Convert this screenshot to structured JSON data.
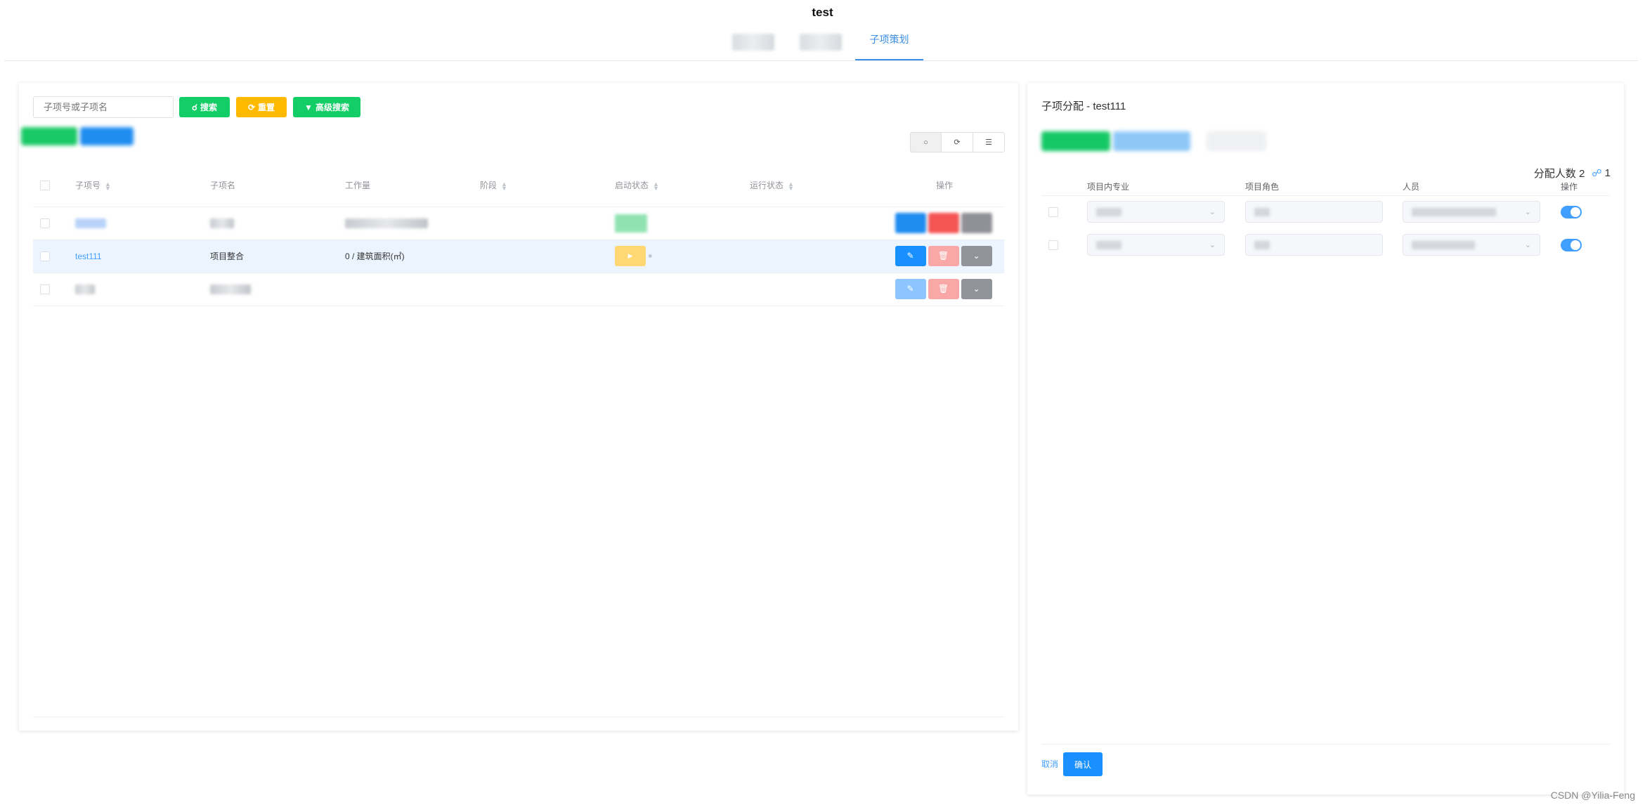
{
  "header": {
    "title": "test",
    "active_tab": "子项策划"
  },
  "left": {
    "search_placeholder": "子项号或子项名",
    "search_button": "搜索",
    "reset_button": "重置",
    "advanced_button": "高级搜索",
    "columns": [
      "子项号",
      "子项名",
      "工作量",
      "阶段",
      "启动状态",
      "运行状态",
      "操作"
    ],
    "sortable_columns": [
      "子项号",
      "阶段",
      "启动状态",
      "运行状态"
    ],
    "rows": [
      {
        "code": "",
        "name": "",
        "workload": "",
        "highlighted": false
      },
      {
        "code": "test111",
        "name": "项目整合",
        "workload": "0 / 建筑面积(㎡)",
        "highlighted": true
      },
      {
        "code": "",
        "name": "",
        "workload": "",
        "highlighted": false
      }
    ]
  },
  "right": {
    "title": "子项分配 - test111",
    "count_label": "分配人数 2",
    "count_badge": "1",
    "columns": [
      "项目内专业",
      "项目角色",
      "人员",
      "操作"
    ],
    "rows": [
      {
        "enabled": true
      },
      {
        "enabled": true
      }
    ],
    "cancel": "取消",
    "confirm": "确认"
  },
  "watermark": "CSDN @Yilia-Feng",
  "colors": {
    "primary": "#409eff",
    "success": "#13ce66",
    "warning": "#ffba00",
    "danger": "#f56c6c",
    "neutral": "#909399"
  }
}
